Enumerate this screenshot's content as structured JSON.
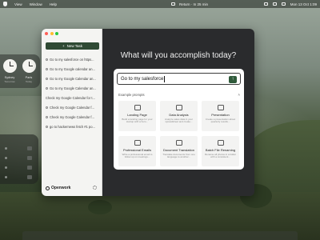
{
  "menubar": {
    "items": [
      "View",
      "Window",
      "Help"
    ],
    "center_text": "Return · In 25 min",
    "clock": "Mon 13 Oct 1:09"
  },
  "clocks": [
    {
      "city": "Sydney",
      "detail": "Tomorrow"
    },
    {
      "city": "Paris",
      "detail": "Today"
    }
  ],
  "sidebar": {
    "new_task_label": "New Task",
    "tasks": [
      "Go to my salesforce on https...",
      "Go to my Google calendar an...",
      "Go to my Google Calendar an...",
      "Go to my Google Calendar an...",
      "Check my Google Calendar for t...",
      "Check my Google Calendar f...",
      "Check my Google Calendar f...",
      "go to hackernews fetch #1 po..."
    ],
    "brand_name": "Openwork"
  },
  "main": {
    "headline": "What will you accomplish today?",
    "input_value": "Go to my salesforce",
    "send_icon": "arrow-up-icon",
    "prompts_label": "Example prompts",
    "tiles": [
      {
        "title": "Landing Page",
        "desc": "Build a landing page for your startup with a hero..."
      },
      {
        "title": "Data Analysis",
        "desc": "Analyze sales data in your spreadsheet and create..."
      },
      {
        "title": "Presentation",
        "desc": "Create a presentation about quarterly results..."
      },
      {
        "title": "Professional Emails",
        "desc": "Write a professional email to follow up on meetings..."
      },
      {
        "title": "Document Translation",
        "desc": "Translate documents from one language to another..."
      },
      {
        "title": "Batch File Renaming",
        "desc": "Rename all photos in a folder with a consistent..."
      }
    ]
  },
  "colors": {
    "accent": "#2f4a34",
    "panel_dark": "#2a2b2d",
    "sidebar_bg": "#f4f4f2"
  }
}
